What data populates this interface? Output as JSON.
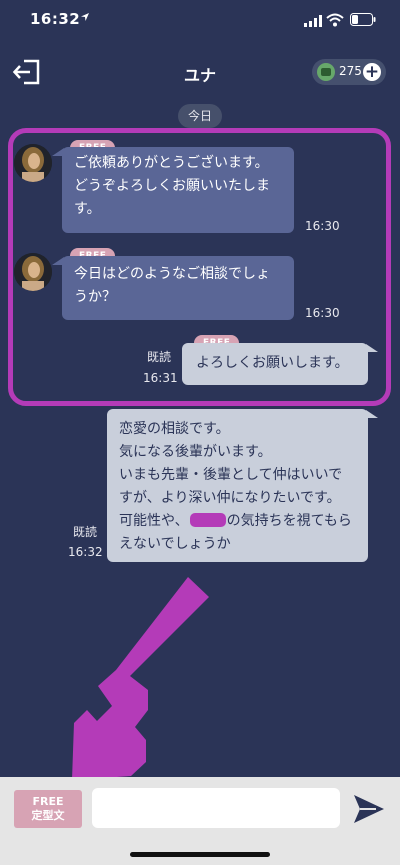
{
  "status": {
    "time": "16:32",
    "location_icon": "arrow-icon",
    "battery": "low"
  },
  "header": {
    "title": "ユナ",
    "points": "275",
    "exit_icon": "exit-icon",
    "plus_icon": "plus-icon"
  },
  "date_divider": "今日",
  "messages": [
    {
      "side": "in",
      "tag": "FREE",
      "lines": [
        "ご依頼ありがとうございます。",
        "どうぞよろしくお願いいたしま",
        "す。"
      ],
      "time": "16:30"
    },
    {
      "side": "in",
      "tag": "FREE",
      "lines": [
        "今日はどのようなご相談でしょ",
        "うか？"
      ],
      "time": "16:30"
    },
    {
      "side": "out",
      "tag": "FREE",
      "lines": [
        "よろしくお願いします。"
      ],
      "read": "既読",
      "time": "16:31"
    },
    {
      "side": "out",
      "tag": "",
      "lines": [
        "恋愛の相談です。",
        "気になる後輩がいます。",
        "いまも先輩・後輩として仲はいいで",
        "すが、より深い仲になりたいです。",
        "可能性や、",
        "の気持ちを視てもら",
        "えないでしょうか"
      ],
      "read": "既読",
      "time": "16:32"
    }
  ],
  "input": {
    "template_tag": "FREE",
    "template_label": "定型文",
    "value": "",
    "placeholder": ""
  },
  "colors": {
    "background": "#2b3457",
    "incoming_bubble": "#5a6696",
    "outgoing_bubble": "#c9cfdb",
    "free_tag": "#d7a3b4",
    "annotation": "#b43bb8"
  }
}
